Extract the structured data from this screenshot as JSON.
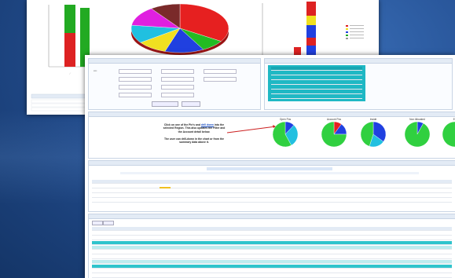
{
  "slide": {
    "background_color": "#234d8c"
  },
  "top_screenshot": {
    "bar_chart_left": {
      "type": "bar",
      "series_colors": [
        "#22aa22",
        "#dd2222"
      ],
      "values": [
        {
          "segments": [
            0.55,
            0.45
          ]
        },
        {
          "segments": [
            1.0,
            0
          ]
        }
      ]
    },
    "pie_chart": {
      "type": "pie",
      "slices": [
        {
          "color": "#e62020",
          "fraction": 0.34
        },
        {
          "color": "#22bb22",
          "fraction": 0.08
        },
        {
          "color": "#2040e0",
          "fraction": 0.13
        },
        {
          "color": "#f0e020",
          "fraction": 0.1
        },
        {
          "color": "#20c0e0",
          "fraction": 0.12
        },
        {
          "color": "#e020e0",
          "fraction": 0.13
        },
        {
          "color": "#7a2a2a",
          "fraction": 0.1
        }
      ]
    },
    "stacked_bar_right": {
      "type": "bar",
      "bars": [
        {
          "segments": [
            {
              "color": "#dd2222",
              "v": 0.45
            },
            {
              "color": "#f0e020",
              "v": 0.25
            },
            {
              "color": "#2040e0",
              "v": 0.3
            }
          ]
        },
        {
          "segments": [
            {
              "color": "#dd2222",
              "v": 0.3
            },
            {
              "color": "#2040e0",
              "v": 0.7
            }
          ]
        }
      ],
      "legend_colors": [
        "#dd2222",
        "#f0e020",
        "#2040e0",
        "#22aa22",
        "#999999"
      ]
    }
  },
  "bottom_screenshot": {
    "annotation_line1": "Click on one of the Pie's and",
    "annotation_link": "drill down",
    "annotation_line1b": "into the",
    "annotation_line2": "selected Region.  This also updates the Filter and",
    "annotation_line3": "the Account detail below.",
    "annotation_line4": "The user can drill-down in the chart or from the",
    "annotation_line5": "summary data above it.",
    "pies": [
      {
        "title": "Open Pos",
        "slices": [
          {
            "color": "#2040e0",
            "fraction": 0.12
          },
          {
            "color": "#22c0e0",
            "fraction": 0.3
          },
          {
            "color": "#30d040",
            "fraction": 0.58
          }
        ]
      },
      {
        "title": "Account Pos",
        "slices": [
          {
            "color": "#e62020",
            "fraction": 0.1
          },
          {
            "color": "#2040e0",
            "fraction": 0.15
          },
          {
            "color": "#30d040",
            "fraction": 0.75
          }
        ]
      },
      {
        "title": "Inside",
        "slices": [
          {
            "color": "#2040e0",
            "fraction": 0.35
          },
          {
            "color": "#22c0e0",
            "fraction": 0.2
          },
          {
            "color": "#30d040",
            "fraction": 0.45
          }
        ]
      },
      {
        "title": "Non Allocated",
        "slices": [
          {
            "color": "#2040e0",
            "fraction": 0.08
          },
          {
            "color": "#30d040",
            "fraction": 0.92
          }
        ]
      },
      {
        "title": "Ext",
        "slices": [
          {
            "color": "#30d040",
            "fraction": 1.0
          }
        ]
      }
    ]
  }
}
